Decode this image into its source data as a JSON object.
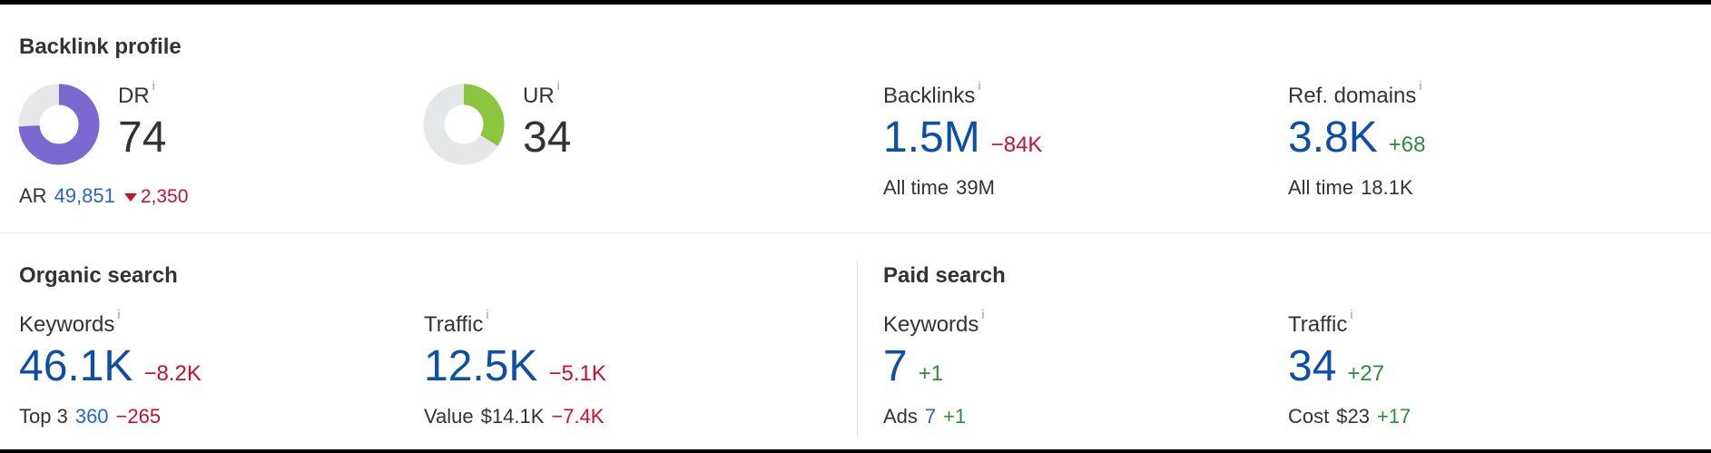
{
  "backlink": {
    "title": "Backlink profile",
    "dr": {
      "label": "DR",
      "value": "74",
      "ar_label": "AR",
      "ar_value": "49,851",
      "ar_delta": "2,350",
      "fraction": 0.74,
      "color": "#7b68d0"
    },
    "ur": {
      "label": "UR",
      "value": "34",
      "fraction": 0.34,
      "color": "#8cc63f"
    },
    "backlinks": {
      "label": "Backlinks",
      "value": "1.5M",
      "delta": "−84K",
      "sub_label": "All time",
      "sub_value": "39M"
    },
    "ref_domains": {
      "label": "Ref. domains",
      "value": "3.8K",
      "delta": "+68",
      "sub_label": "All time",
      "sub_value": "18.1K"
    }
  },
  "organic": {
    "title": "Organic search",
    "keywords": {
      "label": "Keywords",
      "value": "46.1K",
      "delta": "−8.2K",
      "sub_label": "Top 3",
      "sub_value": "360",
      "sub_delta": "−265"
    },
    "traffic": {
      "label": "Traffic",
      "value": "12.5K",
      "delta": "−5.1K",
      "sub_label": "Value",
      "sub_value": "$14.1K",
      "sub_delta": "−7.4K"
    }
  },
  "paid": {
    "title": "Paid search",
    "keywords": {
      "label": "Keywords",
      "value": "7",
      "delta": "+1",
      "sub_label": "Ads",
      "sub_value": "7",
      "sub_delta": "+1"
    },
    "traffic": {
      "label": "Traffic",
      "value": "34",
      "delta": "+27",
      "sub_label": "Cost",
      "sub_value": "$23",
      "sub_delta": "+17"
    }
  },
  "info_glyph": "i"
}
